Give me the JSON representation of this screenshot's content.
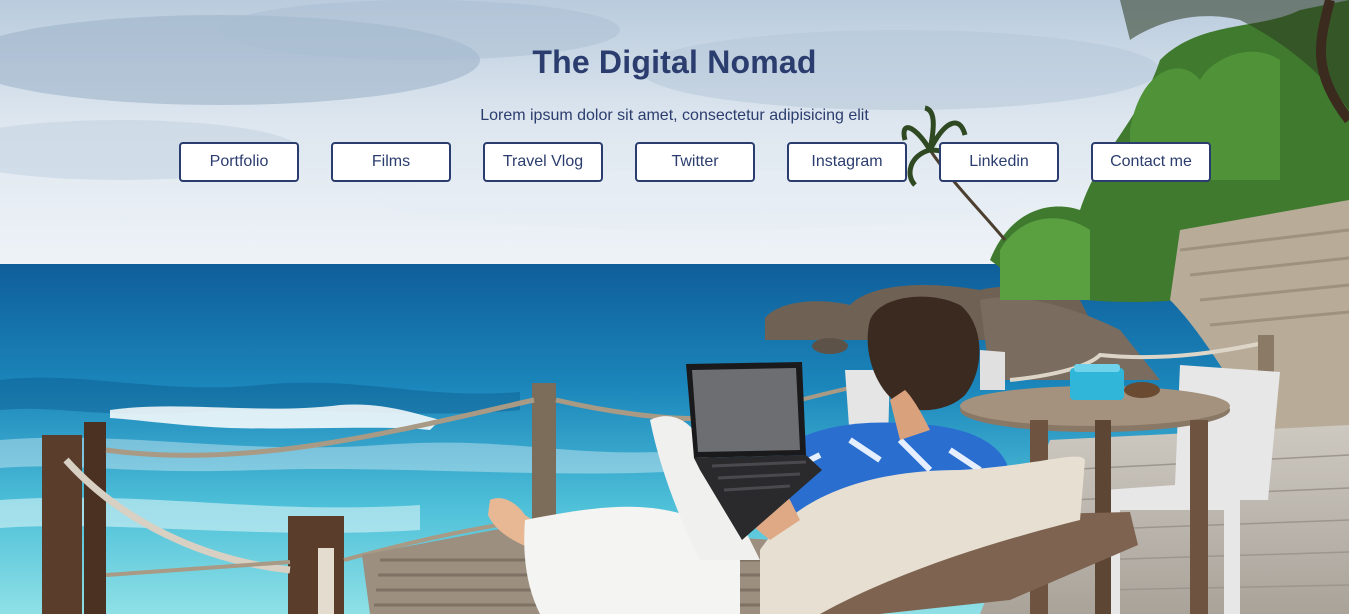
{
  "header": {
    "title": "The Digital Nomad",
    "subtitle": "Lorem ipsum dolor sit amet, consectetur adipisicing elit"
  },
  "nav": {
    "items": [
      {
        "label": "Portfolio"
      },
      {
        "label": "Films"
      },
      {
        "label": "Travel Vlog"
      },
      {
        "label": "Twitter"
      },
      {
        "label": "Instagram"
      },
      {
        "label": "Linkedin"
      },
      {
        "label": "Contact me"
      }
    ]
  },
  "colors": {
    "accent": "#2b3d6e",
    "button_bg": "#ffffff",
    "sky": "#d6e1ec",
    "sea": "#1f8fc2"
  }
}
